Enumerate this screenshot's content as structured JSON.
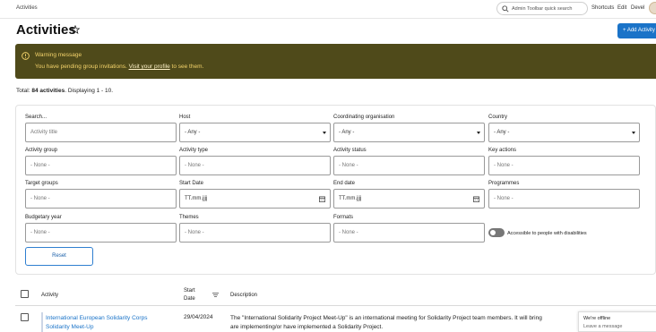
{
  "toolbar": {
    "breadcrumb": "Activities",
    "search_placeholder": "Admin Toolbar quick search",
    "links": [
      "Shortcuts",
      "Edit",
      "Devel"
    ]
  },
  "page": {
    "title": "Activities",
    "add_button": "+ Add Activity"
  },
  "warning": {
    "title": "Warning message",
    "text_before": "You have pending group invitations.",
    "link": "Visit your profile",
    "text_after": "to see them.",
    "close": "×"
  },
  "summary": {
    "prefix": "Total:",
    "count": "84 activities",
    "suffix": ". Displaying 1 - 10."
  },
  "filters": {
    "search_label": "Search...",
    "search_placeholder": "Activity title",
    "host_label": "Host",
    "host_value": "- Any -",
    "coord_label": "Coordinating organisation",
    "coord_value": "- Any -",
    "country_label": "Country",
    "country_value": "- Any -",
    "group_label": "Activity group",
    "group_value": "- None -",
    "type_label": "Activity type",
    "type_value": "- None -",
    "status_label": "Activity status",
    "status_value": "- None -",
    "key_label": "Key actions",
    "key_value": "- None -",
    "target_label": "Target groups",
    "target_value": "- None -",
    "start_label": "Start Date",
    "start_value": "TT.mm.jjjj",
    "end_label": "End date",
    "end_value": "TT.mm.jjjj",
    "programmes_label": "Programmes",
    "programmes_value": "- None -",
    "budget_label": "Budgetary year",
    "budget_value": "- None -",
    "themes_label": "Themes",
    "themes_value": "- None -",
    "formats_label": "Formats",
    "formats_value": "- None -",
    "accessible_label": "Accessible to people with disabilities",
    "reset": "Reset"
  },
  "table": {
    "col_activity": "Activity",
    "col_start_line1": "Start",
    "col_start_line2": "Date",
    "col_description": "Description",
    "rows": [
      {
        "activity": "International European Solidarity Corps Solidarity Meet-Up",
        "start_date": "29/04/2024",
        "description_line1": "The \"International Solidarity Project Meet-Up\" is an international meeting for Solidarity Project team members. It will bring",
        "description_line2": "are implementing/or have implemented a Solidarity Project."
      }
    ]
  },
  "chat": {
    "status": "We're offline",
    "action": "Leave a message"
  }
}
